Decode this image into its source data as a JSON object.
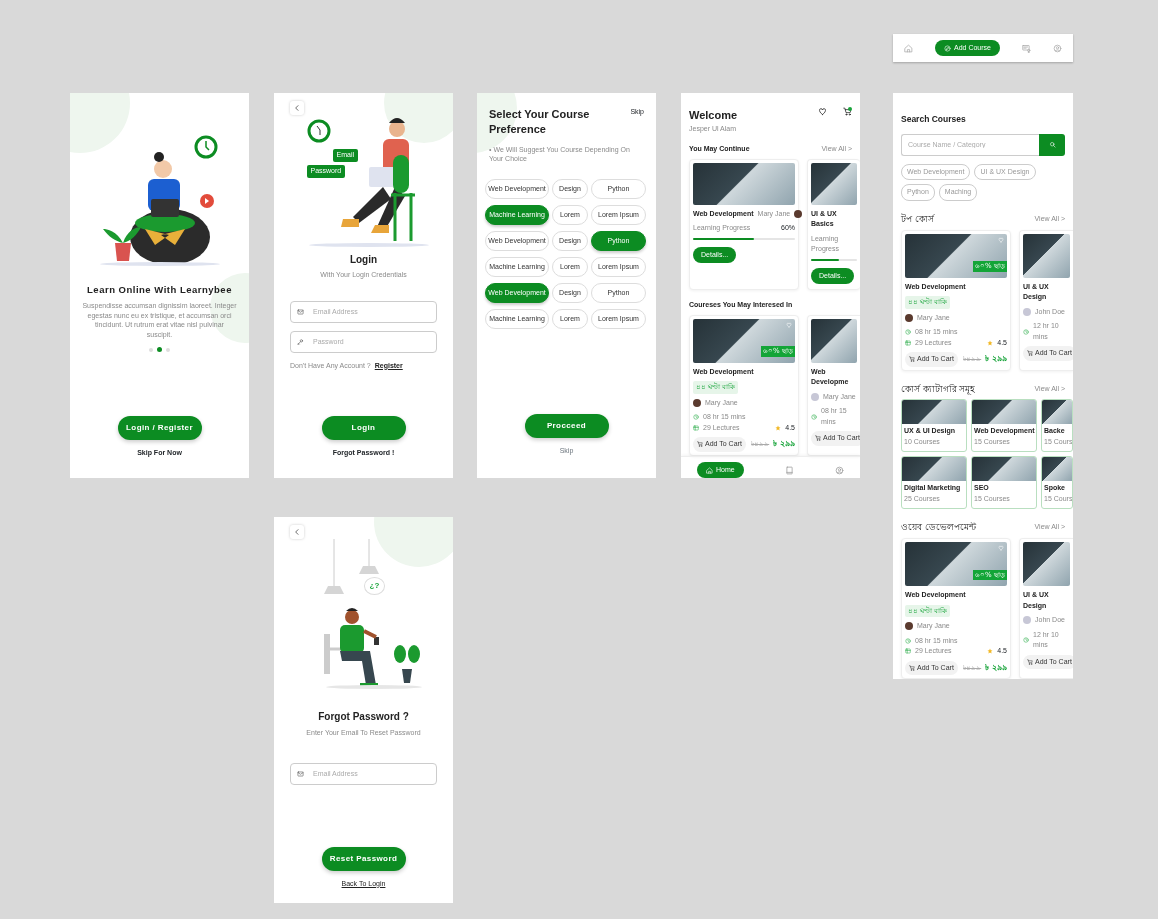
{
  "onboarding": {
    "title": "Learn Online With Learnybee",
    "description": "Suspendisse accumsan dignissim laoreet. Integer egestas nunc eu ex tristique, et accumsan orci tincidunt. Ut rutrum erat vitae nisl pulvinar suscipit.",
    "dots": [
      {
        "selected": false
      },
      {
        "selected": true
      },
      {
        "selected": false
      }
    ],
    "button": "Login / Register",
    "skip": "Skip For Now"
  },
  "login": {
    "bubbles": [
      "Email",
      "Password"
    ],
    "title": "Login",
    "subtitle": "With Your Login Credentials",
    "fields": [
      {
        "kind": "email",
        "placeholder": "Email Address"
      },
      {
        "kind": "password",
        "placeholder": "Password"
      }
    ],
    "prompt": "Don't Have Any Account ?",
    "register": "Register",
    "button": "Login",
    "forgot": "Forgot Password !"
  },
  "preference": {
    "title": "Select Your Course Preference",
    "skip_top": "Skip",
    "hint": "• We Will Suggest You Course Depending On Your Choice",
    "chips": [
      {
        "label": "Web Development",
        "selected": false
      },
      {
        "label": "Design",
        "selected": false
      },
      {
        "label": "Python",
        "selected": false
      },
      {
        "label": "Machine Learning",
        "selected": true
      },
      {
        "label": "Lorem",
        "selected": false
      },
      {
        "label": "Lorem Ipsum",
        "selected": false
      },
      {
        "label": "Web Development",
        "selected": false
      },
      {
        "label": "Design",
        "selected": false
      },
      {
        "label": "Python",
        "selected": true
      },
      {
        "label": "Machine Learning",
        "selected": false
      },
      {
        "label": "Lorem",
        "selected": false
      },
      {
        "label": "Lorem Ipsum",
        "selected": false
      },
      {
        "label": "Web Development",
        "selected": true
      },
      {
        "label": "Design",
        "selected": false
      },
      {
        "label": "Python",
        "selected": false
      },
      {
        "label": "Machine Learning",
        "selected": false
      },
      {
        "label": "Lorem",
        "selected": false
      },
      {
        "label": "Lorem Ipsum",
        "selected": false
      }
    ],
    "button": "Procceed",
    "skip": "Skip"
  },
  "home": {
    "title": "Welcome",
    "user": "Jesper Ul Alam",
    "cart_has_items": true,
    "continue": {
      "title": "You May Continue",
      "view_all": "View All >",
      "cards": [
        {
          "title": "Web Development",
          "instructor": "Mary Jane",
          "progress_label": "Learning Progress",
          "percent": "60%",
          "level": 0.6,
          "button": "Details..."
        },
        {
          "title": "UI & UX Basics",
          "progress_label": "Learning Progress",
          "level": 0.6,
          "button": "Details..."
        }
      ]
    },
    "interest": {
      "title": "Coureses You May Interesed In",
      "cards": [
        {
          "title": "Web Development",
          "badge": "৪৪ ঘণ্টা বাকি",
          "discount": "৬০% ছাড়",
          "instructor": "Mary Jane",
          "duration": "08 hr 15 mins",
          "lectures": "29 Lectures",
          "rating": "4.5",
          "cart": "Add To Cart",
          "old_price": "৳৪৯৯",
          "price": "৳ ২৯৯"
        },
        {
          "title": "Web Developme",
          "instructor": "Mary Jane",
          "duration": "08 hr 15 mins",
          "cart": "Add To Cart"
        }
      ]
    },
    "nav": [
      {
        "kind": "home",
        "label": "Home",
        "selected": true
      },
      {
        "kind": "book",
        "selected": false
      },
      {
        "kind": "profile",
        "selected": false
      }
    ]
  },
  "nav_bar": {
    "items": [
      {
        "kind": "home",
        "selected": false
      },
      {
        "kind": "add",
        "label": "Add Course",
        "selected": true
      },
      {
        "kind": "certificate",
        "selected": false
      },
      {
        "kind": "profile",
        "selected": false
      }
    ]
  },
  "search": {
    "title": "Search Courses",
    "placeholder": "Course Name / Category",
    "chips": [
      "Web Development",
      "UI & UX Design",
      "Python",
      "Maching"
    ],
    "sections": [
      {
        "kind": "courses",
        "title": "টপ কোর্স",
        "view_all": "View All >",
        "cards": [
          {
            "title": "Web Development",
            "badge": "৪৪ ঘণ্টা বাকি",
            "discount": "৬০% ছাড়",
            "instructor": "Mary Jane",
            "duration": "08 hr 15 mins",
            "lectures": "29 Lectures",
            "rating": "4.5",
            "cart": "Add To Cart",
            "old_price": "৳৪৯৯",
            "price": "৳ ২৯৯"
          },
          {
            "title": "UI & UX Design",
            "instructor": "John Doe",
            "duration": "12 hr 10 mins",
            "cart": "Add To Cart"
          }
        ]
      },
      {
        "kind": "categories",
        "title": "কোর্স ক্যাটাগরি সমূহ",
        "view_all": "View All >",
        "items": [
          {
            "name": "UX & UI Design",
            "count": "10 Courses"
          },
          {
            "name": "Web Development",
            "count": "15 Courses"
          },
          {
            "name": "Backe",
            "count": "15 Cours"
          },
          {
            "name": "Digital Marketing",
            "count": "25 Courses"
          },
          {
            "name": "SEO",
            "count": "15 Courses"
          },
          {
            "name": "Spoke",
            "count": "15 Cours"
          }
        ]
      },
      {
        "kind": "courses",
        "title": "ওয়েব ডেভেলপমেন্ট",
        "view_all": "View All >",
        "cards": [
          {
            "title": "Web Development",
            "badge": "৪৪ ঘণ্টা বাকি",
            "discount": "৬০% ছাড়",
            "instructor": "Mary Jane",
            "duration": "08 hr 15 mins",
            "lectures": "29 Lectures",
            "rating": "4.5",
            "cart": "Add To Cart",
            "old_price": "৳৪৯৯",
            "price": "৳ ২৯৯"
          },
          {
            "title": "UI & UX Design",
            "instructor": "John Doe",
            "duration": "12 hr 10 mins",
            "cart": "Add To Cart"
          }
        ]
      }
    ]
  },
  "forgot": {
    "bubble": "¿?",
    "title": "Forgot Password ?",
    "subtitle": "Enter Your Email To Reset Password",
    "field": {
      "kind": "email",
      "placeholder": "Email Address"
    },
    "button": "Reset Password",
    "back": "Back To Login"
  }
}
